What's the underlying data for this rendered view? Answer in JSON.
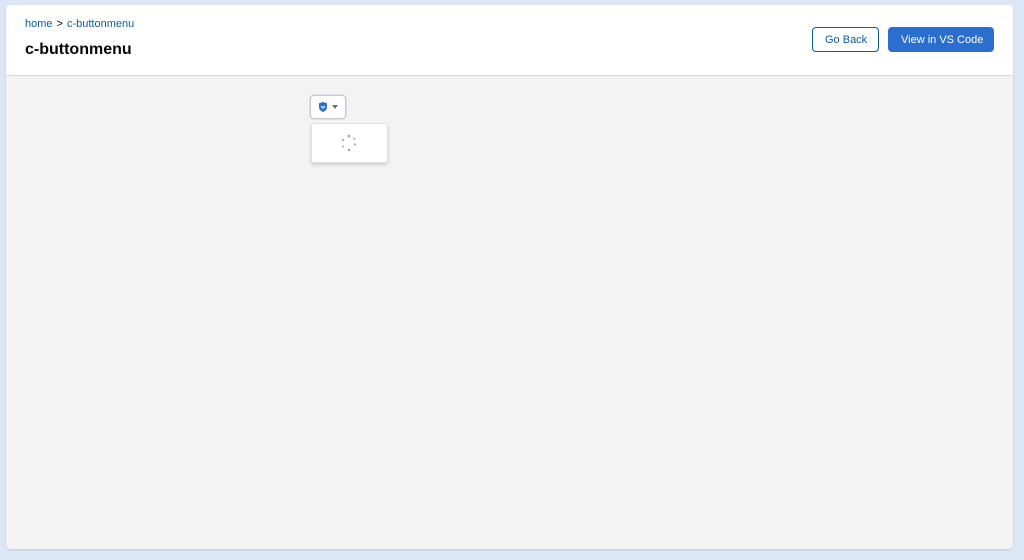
{
  "breadcrumb": {
    "home": "home",
    "separator": ">",
    "current": "c-buttonmenu"
  },
  "page": {
    "title": "c-buttonmenu"
  },
  "actions": {
    "go_back": "Go Back",
    "view_vscode": "View in VS Code"
  },
  "button_menu": {
    "icon": "shield-icon",
    "caret": "chevron-down-icon",
    "dropdown_state": "loading"
  },
  "colors": {
    "brand": "#2a6fd0",
    "link": "#0b5cab",
    "background": "#f3f3f3",
    "outer": "#dbe6f6"
  }
}
